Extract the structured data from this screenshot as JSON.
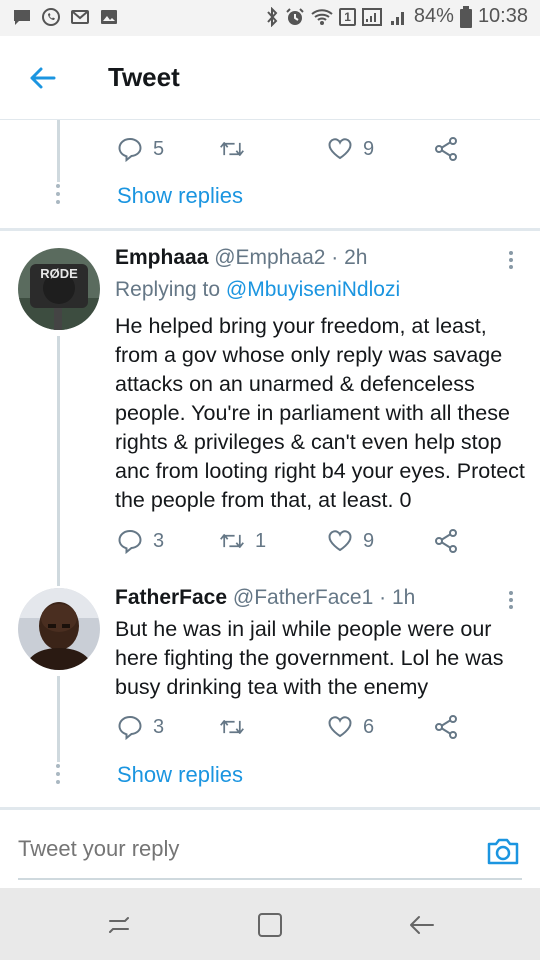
{
  "status_bar": {
    "battery_percent": "84%",
    "time": "10:38",
    "sim_badge": "1"
  },
  "header": {
    "title": "Tweet"
  },
  "top_tweet": {
    "reply_count": "5",
    "retweet_count": "",
    "like_count": "9",
    "show_replies": "Show replies"
  },
  "tweets": [
    {
      "name": "Emphaaa",
      "handle": "@Emphaa2",
      "time": "· 2h",
      "replying_prefix": "Replying to",
      "replying_handle": "@MbuyiseniNdlozi",
      "text": "He helped bring your freedom, at least, from a gov whose only reply was savage attacks on an unarmed & defenceless people. You're in parliament with all these rights & privileges & can't even help stop anc from looting right b4 your eyes. Protect the people from that, at least. 0",
      "reply_count": "3",
      "retweet_count": "1",
      "like_count": "9",
      "avatar_label": "RØDE"
    },
    {
      "name": "FatherFace",
      "handle": "@FatherFace1",
      "time": "· 1h",
      "text": "But he was in jail while people were our here fighting the government. Lol he was busy drinking tea with the enemy",
      "reply_count": "3",
      "retweet_count": "",
      "like_count": "6",
      "show_replies": "Show replies"
    }
  ],
  "composer": {
    "placeholder": "Tweet your reply"
  },
  "colors": {
    "accent": "#1b95e0",
    "muted": "#657786",
    "thread": "#cfd9de"
  }
}
